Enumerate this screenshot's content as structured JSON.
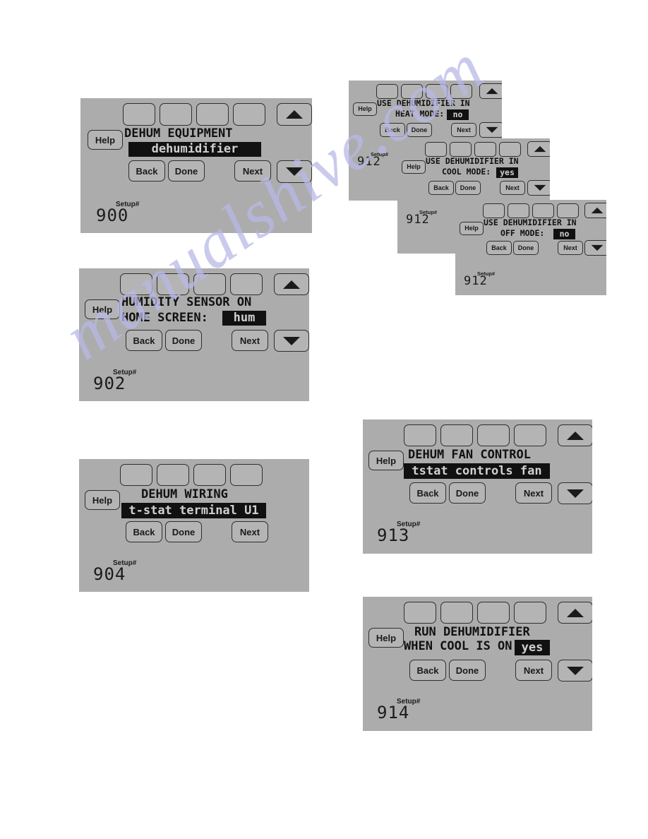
{
  "page": {
    "background_color": "#ffffff",
    "watermark_text": "manualshive.com",
    "watermark_color": "#b9b9e8"
  },
  "common": {
    "help_label": "Help",
    "back_label": "Back",
    "done_label": "Done",
    "next_label": "Next",
    "setup_label": "Setup#",
    "screen_color": "#acacac",
    "button_color": "#b4b4b4",
    "highlight_color": "#111111"
  },
  "screens": [
    {
      "id": "setup-900",
      "title_line1": "DEHUM EQUIPMENT",
      "title_line2": "",
      "value": "dehumidifier",
      "value_style": "full-width-inverse",
      "setup_label": "Setup#",
      "setup_number": "900"
    },
    {
      "id": "setup-902",
      "title_line1": "HUMIDITY SENSOR ON",
      "title_line2": "HOME SCREEN:",
      "value": "hum",
      "value_style": "inline-inverse",
      "setup_label": "Setup#",
      "setup_number": "902"
    },
    {
      "id": "setup-904",
      "title_line1": "DEHUM WIRING",
      "title_line2": "",
      "value": "t-stat terminal U1",
      "value_style": "full-width-inverse",
      "setup_label": "Setup#",
      "setup_number": "904"
    },
    {
      "id": "setup-912-heat",
      "title_line1": "USE DEHUMIDIFIER IN",
      "title_line2": "HEAT MODE:",
      "value": "no",
      "value_style": "inline-inverse",
      "setup_label": "Setup#",
      "setup_number": "912"
    },
    {
      "id": "setup-912-cool",
      "title_line1": "USE DEHUMIDIFIER IN",
      "title_line2": "COOL MODE:",
      "value": "yes",
      "value_style": "inline-inverse",
      "setup_label": "Setup#",
      "setup_number": "912"
    },
    {
      "id": "setup-912-off",
      "title_line1": "USE DEHUMIDIFIER IN",
      "title_line2": "OFF MODE:",
      "value": "no",
      "value_style": "inline-inverse",
      "setup_label": "Setup#",
      "setup_number": "912"
    },
    {
      "id": "setup-913",
      "title_line1": "DEHUM FAN CONTROL",
      "title_line2": "",
      "value": "tstat controls fan",
      "value_style": "full-width-inverse",
      "setup_label": "Setup#",
      "setup_number": "913"
    },
    {
      "id": "setup-914",
      "title_line1": "RUN DEHUMIDIFIER",
      "title_line2": "WHEN COOL IS ON:",
      "value": "yes",
      "value_style": "inline-inverse",
      "setup_label": "Setup#",
      "setup_number": "914"
    }
  ]
}
